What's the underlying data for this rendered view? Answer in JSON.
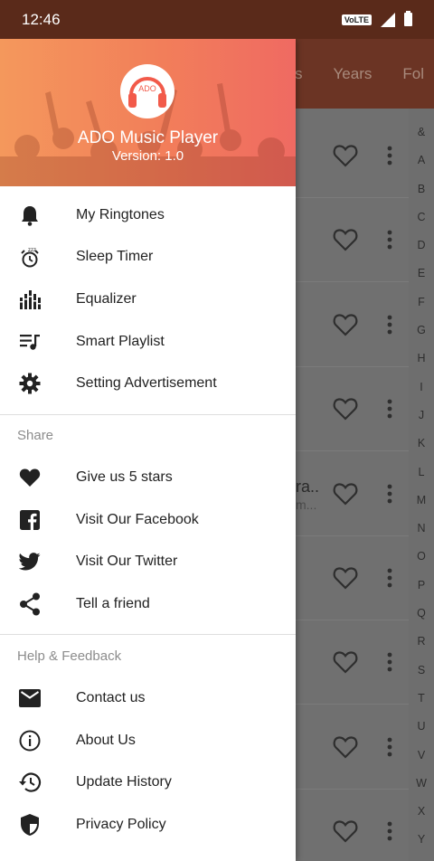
{
  "status_bar": {
    "time": "12:46",
    "network": "VoLTE"
  },
  "app": {
    "tabs": [
      "s",
      "Years",
      "Fol"
    ],
    "rows": [
      {
        "title": "",
        "subtitle": ""
      },
      {
        "title": "",
        "subtitle": ""
      },
      {
        "title": "",
        "subtitle": ""
      },
      {
        "title": "",
        "subtitle": ""
      },
      {
        "title": "ra..",
        "subtitle": "m..."
      },
      {
        "title": "",
        "subtitle": ""
      },
      {
        "title": "",
        "subtitle": ""
      },
      {
        "title": "",
        "subtitle": ""
      },
      {
        "title": "",
        "subtitle": ""
      }
    ],
    "alphabet": [
      "&",
      "A",
      "B",
      "C",
      "D",
      "E",
      "F",
      "G",
      "H",
      "I",
      "J",
      "K",
      "L",
      "M",
      "N",
      "O",
      "P",
      "Q",
      "R",
      "S",
      "T",
      "U",
      "V",
      "W",
      "X",
      "Y"
    ]
  },
  "drawer": {
    "header": {
      "logo_text": "ADO",
      "app_name": "ADO Music Player",
      "version": "Version: 1.0"
    },
    "main_items": [
      {
        "label": "My Ringtones",
        "icon": "bell-icon"
      },
      {
        "label": "Sleep Timer",
        "icon": "alarm-clock-icon"
      },
      {
        "label": "Equalizer",
        "icon": "equalizer-icon"
      },
      {
        "label": "Smart Playlist",
        "icon": "playlist-icon"
      },
      {
        "label": "Setting Advertisement",
        "icon": "gear-icon"
      }
    ],
    "share_title": "Share",
    "share_items": [
      {
        "label": "Give us 5 stars",
        "icon": "heart-icon"
      },
      {
        "label": "Visit Our Facebook",
        "icon": "facebook-icon"
      },
      {
        "label": "Visit Our Twitter",
        "icon": "twitter-icon"
      },
      {
        "label": "Tell a friend",
        "icon": "share-icon"
      }
    ],
    "help_title": "Help & Feedback",
    "help_items": [
      {
        "label": "Contact us",
        "icon": "mail-icon"
      },
      {
        "label": "About Us",
        "icon": "info-icon"
      },
      {
        "label": "Update History",
        "icon": "history-icon"
      },
      {
        "label": "Privacy Policy",
        "icon": "shield-icon"
      }
    ]
  }
}
